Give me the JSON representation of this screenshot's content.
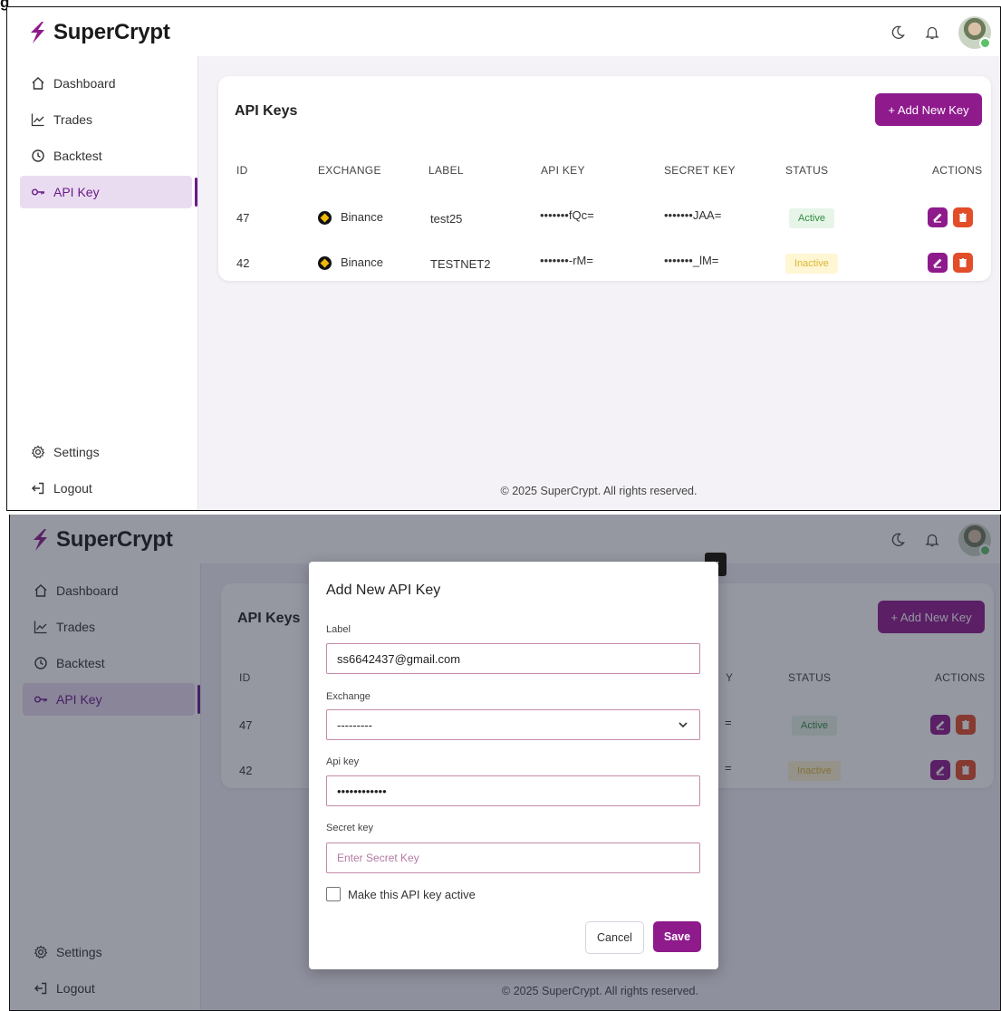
{
  "figure_letter": "g",
  "brand": {
    "name": "SuperCrypt",
    "accent": "#8e1a8c"
  },
  "sidebar": {
    "items": [
      {
        "label": "Dashboard",
        "icon": "home-icon"
      },
      {
        "label": "Trades",
        "icon": "chart-line-icon"
      },
      {
        "label": "Backtest",
        "icon": "history-icon"
      },
      {
        "label": "API Key",
        "icon": "key-icon",
        "active": true
      }
    ],
    "bottom_items": [
      {
        "label": "Settings",
        "icon": "gear-icon"
      },
      {
        "label": "Logout",
        "icon": "logout-icon"
      }
    ]
  },
  "topbar": {
    "icons": [
      "moon-icon",
      "bell-icon",
      "avatar"
    ]
  },
  "api_keys": {
    "title": "API Keys",
    "add_button": "+ Add New Key",
    "columns": [
      "ID",
      "EXCHANGE",
      "LABEL",
      "API KEY",
      "SECRET KEY",
      "STATUS",
      "ACTIONS"
    ],
    "rows": [
      {
        "id": "47",
        "exchange": "Binance",
        "label": "test25",
        "api_key": "•••••••fQc=",
        "secret_key": "•••••••JAA=",
        "status": "Active"
      },
      {
        "id": "42",
        "exchange": "Binance",
        "label": "TESTNET2",
        "api_key": "•••••••-rM=",
        "secret_key": "•••••••_lM=",
        "status": "Inactive"
      }
    ]
  },
  "footer": "© 2025 SuperCrypt. All rights reserved.",
  "modal": {
    "title": "Add New API Key",
    "close_label": "×",
    "fields": {
      "label": {
        "label": "Label",
        "value": "ss6642437@gmail.com"
      },
      "exchange": {
        "label": "Exchange",
        "value": "---------"
      },
      "api_key": {
        "label": "Api key",
        "value": "••••••••••••"
      },
      "secret_key": {
        "label": "Secret key",
        "placeholder": "Enter Secret Key"
      }
    },
    "checkbox_label": "Make this API key active",
    "cancel": "Cancel",
    "save": "Save"
  },
  "overlay_col_fragments": {
    "api_key_tail": "Y",
    "row1": "=",
    "row2": "="
  },
  "colors": {
    "active_bg": "#e7f5e9",
    "active_text": "#2f8c3d",
    "inactive_bg": "#fff6d3",
    "inactive_text": "#d9b733",
    "delete": "#e24d2a"
  }
}
